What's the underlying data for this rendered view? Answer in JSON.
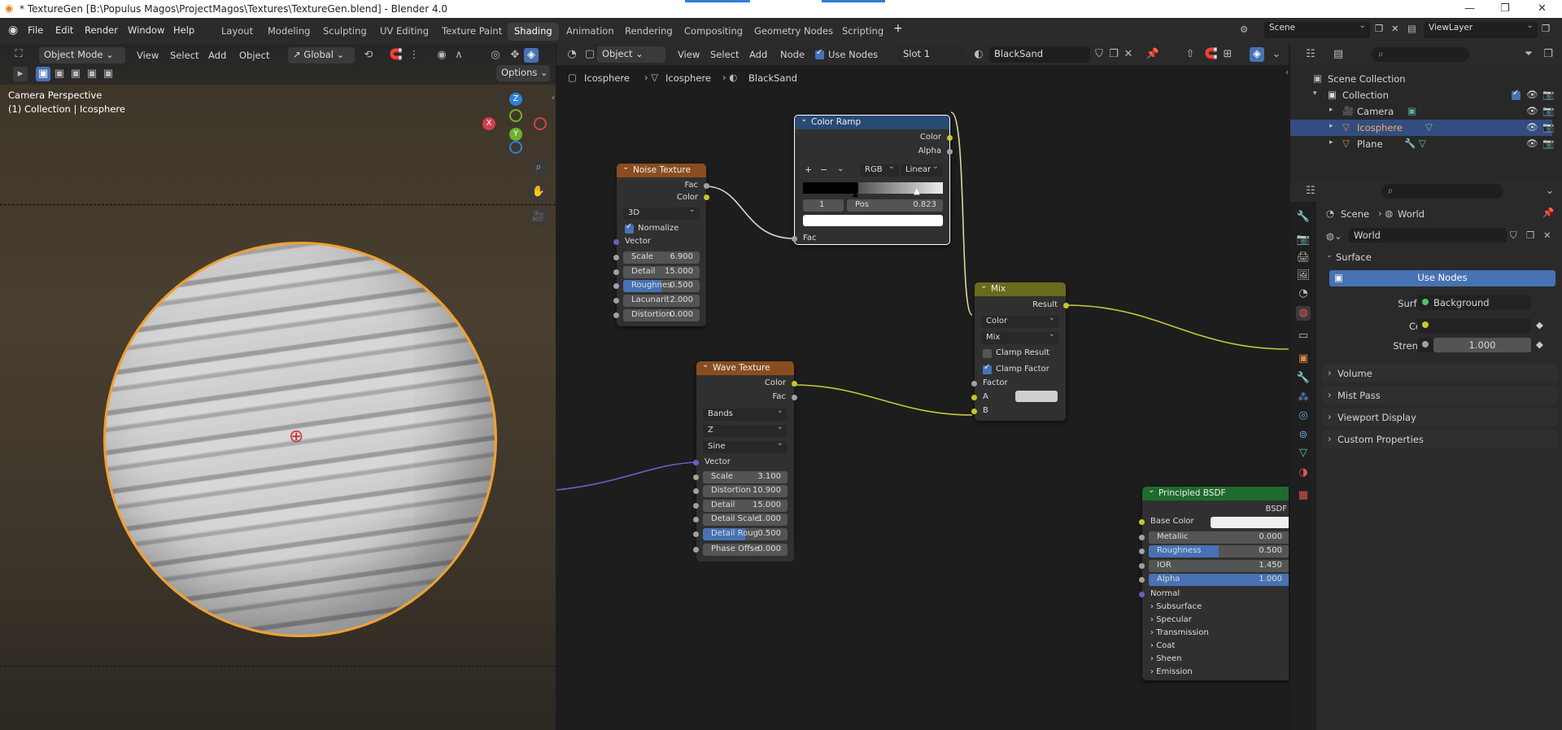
{
  "window": {
    "title": "* TextureGen [B:\\Populus Magos\\ProjectMagos\\Textures\\TextureGen.blend] - Blender 4.0"
  },
  "menu": [
    "File",
    "Edit",
    "Render",
    "Window",
    "Help"
  ],
  "workspaces": [
    "Layout",
    "Modeling",
    "Sculpting",
    "UV Editing",
    "Texture Paint",
    "Shading",
    "Animation",
    "Rendering",
    "Compositing",
    "Geometry Nodes",
    "Scripting"
  ],
  "active_workspace": "Shading",
  "scene": {
    "label": "Scene",
    "viewlayer": "ViewLayer"
  },
  "viewport": {
    "mode": "Object Mode",
    "menus": [
      "View",
      "Select",
      "Add",
      "Object"
    ],
    "orientation": "Global",
    "options": "Options",
    "camera_label": "Camera Perspective",
    "collection_label": "(1) Collection | Icosphere",
    "gizmo": {
      "z": "Z",
      "y": "Y",
      "x": "X"
    }
  },
  "node_editor": {
    "object_dd": "Object",
    "menus": [
      "View",
      "Select",
      "Add",
      "Node"
    ],
    "use_nodes": "Use Nodes",
    "slot": "Slot 1",
    "material": "BlackSand",
    "breadcrumb": [
      "Icosphere",
      "Icosphere",
      "BlackSand"
    ]
  },
  "nodes": {
    "noise": {
      "title": "Noise Texture",
      "out_fac": "Fac",
      "out_color": "Color",
      "dim": "3D",
      "normalize": "Normalize",
      "vector": "Vector",
      "fields": [
        {
          "label": "Scale",
          "value": "6.900"
        },
        {
          "label": "Detail",
          "value": "15.000"
        },
        {
          "label": "Roughnes",
          "value": "0.500",
          "fill": 0.5
        },
        {
          "label": "Lacunarit",
          "value": "2.000"
        },
        {
          "label": "Distortion",
          "value": "0.000"
        }
      ]
    },
    "ramp": {
      "title": "Color Ramp",
      "out_color": "Color",
      "out_alpha": "Alpha",
      "mode": "RGB",
      "interp": "Linear",
      "index": "1",
      "pos_label": "Pos",
      "pos_value": "0.823",
      "in_fac": "Fac"
    },
    "mix": {
      "title": "Mix",
      "out": "Result",
      "type": "Color",
      "blend": "Mix",
      "clamp_result": "Clamp Result",
      "clamp_factor": "Clamp Factor",
      "factor": "Factor",
      "a": "A",
      "b": "B"
    },
    "wave": {
      "title": "Wave Texture",
      "out_color": "Color",
      "out_fac": "Fac",
      "type": "Bands",
      "axis": "Z",
      "profile": "Sine",
      "vector": "Vector",
      "fields": [
        {
          "label": "Scale",
          "value": "3.100"
        },
        {
          "label": "Distortion",
          "value": "10.900"
        },
        {
          "label": "Detail",
          "value": "15.000"
        },
        {
          "label": "Detail Scale",
          "value": "1.000"
        },
        {
          "label": "Detail Roug",
          "value": "0.500",
          "fill": 0.5
        },
        {
          "label": "Phase Offse",
          "value": "0.000"
        }
      ]
    },
    "bsdf": {
      "title": "Principled BSDF",
      "out": "BSDF",
      "base_color": "Base Color",
      "fields": [
        {
          "label": "Metallic",
          "value": "0.000"
        },
        {
          "label": "Roughness",
          "value": "0.500",
          "fill": 0.5
        },
        {
          "label": "IOR",
          "value": "1.450"
        },
        {
          "label": "Alpha",
          "value": "1.000",
          "fill": 1.0
        }
      ],
      "normal": "Normal",
      "panels": [
        "Subsurface",
        "Specular",
        "Transmission",
        "Coat",
        "Sheen",
        "Emission"
      ]
    }
  },
  "outliner": {
    "root": "Scene Collection",
    "collection": "Collection",
    "items": [
      "Camera",
      "Icosphere",
      "Plane"
    ]
  },
  "properties": {
    "breadcrumb": [
      "Scene",
      "World"
    ],
    "world_name": "World",
    "surface_section": "Surface",
    "use_nodes": "Use Nodes",
    "surface_label": "Surface",
    "surface_value": "Background",
    "color_label": "Color",
    "strength_label": "Strength",
    "strength_value": "1.000",
    "sections": [
      "Volume",
      "Mist Pass",
      "Viewport Display",
      "Custom Properties"
    ]
  },
  "colors": {
    "header_noise": "#8a4d1f",
    "header_wave": "#8a4d1f",
    "header_ramp": "#274b74",
    "header_mix": "#6a6a1c",
    "header_bsdf": "#1f6b2d",
    "accent": "#4772b3",
    "selection_orange": "#f0a030"
  }
}
